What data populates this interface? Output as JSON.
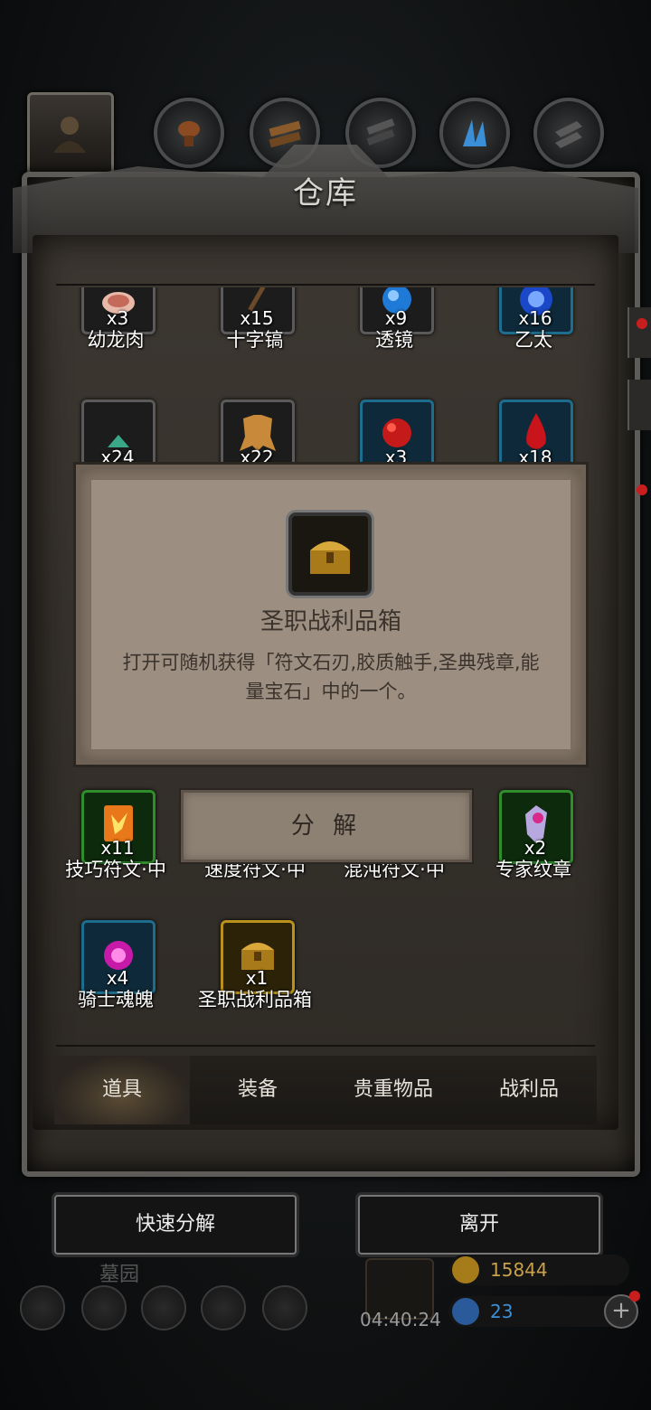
{
  "title": "仓库",
  "top_tabs": [
    "avatar",
    "meat",
    "wood",
    "ore",
    "crystal",
    "iron"
  ],
  "row1": [
    {
      "name": "幼龙肉",
      "count": "x3",
      "icon": "meat-icon",
      "rarity": "normal"
    },
    {
      "name": "十字镐",
      "count": "x15",
      "icon": "pickaxe-icon",
      "rarity": "normal"
    },
    {
      "name": "透镜",
      "count": "x9",
      "icon": "lens-icon",
      "rarity": "normal"
    },
    {
      "name": "乙太",
      "count": "x16",
      "icon": "ether-icon",
      "rarity": "blue"
    }
  ],
  "row2": [
    {
      "count": "x24",
      "icon": "crystal-shard-icon",
      "rarity": "normal"
    },
    {
      "count": "x22",
      "icon": "hide-icon",
      "rarity": "normal"
    },
    {
      "count": "x3",
      "icon": "red-ore-icon",
      "rarity": "blue"
    },
    {
      "count": "x18",
      "icon": "blood-drop-icon",
      "rarity": "blue"
    }
  ],
  "row4": [
    {
      "name": "技巧符文·中",
      "count": "x11",
      "icon": "skill-rune-icon",
      "rarity": "green"
    },
    {
      "name": "速度符文·中",
      "icon": "speed-rune-icon",
      "rarity": "green"
    },
    {
      "name": "混沌符文·中",
      "icon": "chaos-rune-icon",
      "rarity": "green"
    },
    {
      "name": "专家纹章",
      "count": "x2",
      "icon": "expert-crest-icon",
      "rarity": "green"
    }
  ],
  "row5": [
    {
      "name": "骑士魂魄",
      "count": "x4",
      "icon": "knight-soul-icon",
      "rarity": "blue"
    },
    {
      "name": "圣职战利品箱",
      "count": "x1",
      "icon": "treasure-chest-icon",
      "rarity": "gold"
    }
  ],
  "popup": {
    "title": "圣职战利品箱",
    "description": "打开可随机获得「符文石刃,胶质触手,圣典残章,能量宝石」中的一个。",
    "action": "分 解"
  },
  "bottom_tabs": [
    "道具",
    "装备",
    "贵重物品",
    "战利品"
  ],
  "active_tab": "道具",
  "buttons": {
    "quick_decompose": "快速分解",
    "leave": "离开"
  },
  "hud": {
    "location": "墓园",
    "timer": "04:40:24",
    "gold": "15844",
    "gems": "23"
  },
  "colors": {
    "gold_text": "#c9a14a",
    "gem_text": "#3d8fd6"
  }
}
